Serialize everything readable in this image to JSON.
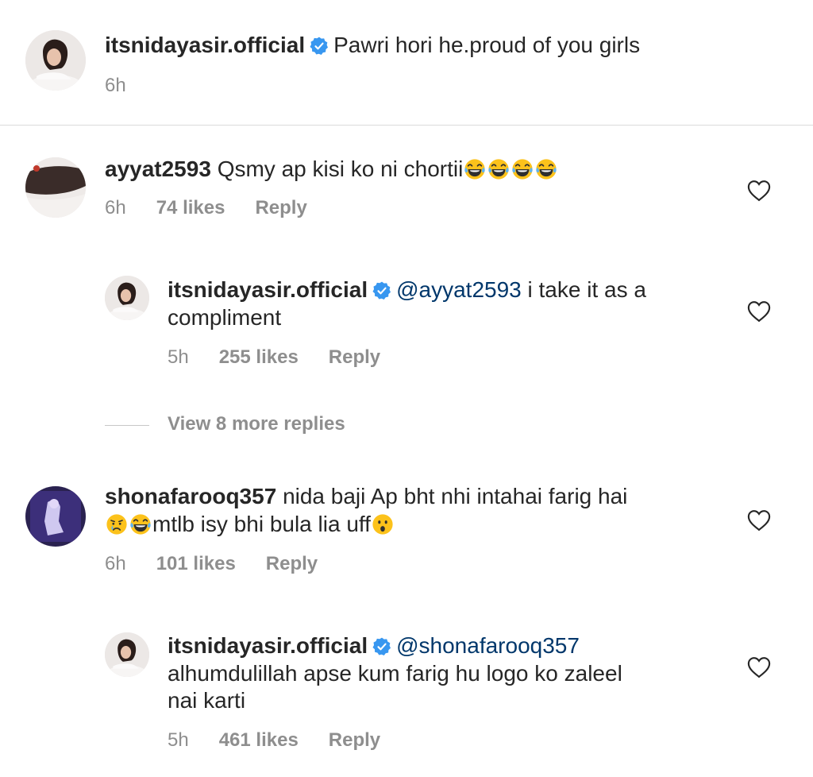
{
  "caption": {
    "username": "itsnidayasir.official",
    "text": "Pawri hori he.proud of you girls",
    "time": "6h"
  },
  "comments": [
    {
      "username": "ayyat2593",
      "text": "Qsmy ap kisi ko ni chortii",
      "emojis": [
        "face-with-tears-of-joy",
        "face-with-tears-of-joy",
        "face-with-tears-of-joy",
        "face-with-tears-of-joy"
      ],
      "time": "6h",
      "likes": "74 likes",
      "reply": "Reply"
    },
    {
      "username": "itsnidayasir.official",
      "mention": "@ayyat2593",
      "text_line1": "i take it as a",
      "text_line2": "compliment",
      "time": "5h",
      "likes": "255 likes",
      "reply": "Reply"
    },
    {
      "username": "shonafarooq357",
      "text_line1": "nida baji Ap bht nhi intahai farig hai",
      "text_line2": "mtlb isy bhi bula lia uff",
      "time": "6h",
      "likes": "101 likes",
      "reply": "Reply"
    },
    {
      "username": "itsnidayasir.official",
      "mention": "@shonafarooq357",
      "text_line1": "alhumdulillah apse kum farig hu logo ko zaleel",
      "text_line2": "nai karti",
      "time": "5h",
      "likes": "461 likes",
      "reply": "Reply"
    }
  ],
  "view_more": "View 8 more replies",
  "colors": {
    "text": "#262626",
    "secondary": "#8e8e8e",
    "mention": "#00376b",
    "verified": "#3897f0",
    "divider": "#dbdbdb"
  }
}
